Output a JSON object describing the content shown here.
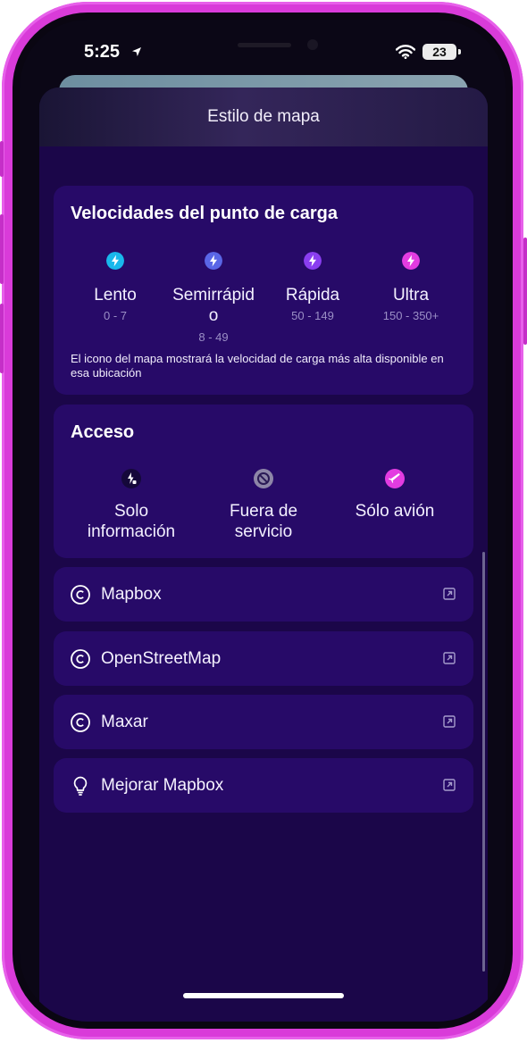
{
  "status_bar": {
    "time": "5:25",
    "battery": "23"
  },
  "sheet": {
    "title": "Estilo de mapa"
  },
  "speeds": {
    "title": "Velocidades del punto de carga",
    "items": [
      {
        "name": "Lento",
        "range": "0 - 7",
        "color": "#19b8ec",
        "icon": "bolt-icon"
      },
      {
        "name": "Semirrápid",
        "name_cont": "o",
        "range": "8 - 49",
        "color": "#5a66e6",
        "icon": "bolt-icon"
      },
      {
        "name": "Rápida",
        "range": "50 - 149",
        "color": "#8a3ef0",
        "icon": "bolt-icon"
      },
      {
        "name": "Ultra",
        "range": "150 - 350+",
        "color": "#e33ce1",
        "icon": "bolt-icon"
      }
    ],
    "note": "El icono del mapa mostrará la velocidad de carga más alta disponible en esa ubicación"
  },
  "access": {
    "title": "Acceso",
    "items": [
      {
        "line1": "Solo",
        "line2": "información",
        "icon": "info-bolt-icon"
      },
      {
        "line1": "Fuera de",
        "line2": "servicio",
        "icon": "blocked-icon"
      },
      {
        "line1": "Sólo avión",
        "line2": "",
        "icon": "airplane-icon",
        "color": "#e33ce1"
      }
    ]
  },
  "links": [
    {
      "label": "Mapbox",
      "icon": "copyright-icon"
    },
    {
      "label": "OpenStreetMap",
      "icon": "copyright-icon"
    },
    {
      "label": "Maxar",
      "icon": "copyright-icon"
    },
    {
      "label": "Mejorar Mapbox",
      "icon": "lightbulb-icon"
    }
  ],
  "colors": {
    "frame": "#d93bd9",
    "sheet": "#1b0649",
    "card": "#270a68"
  }
}
